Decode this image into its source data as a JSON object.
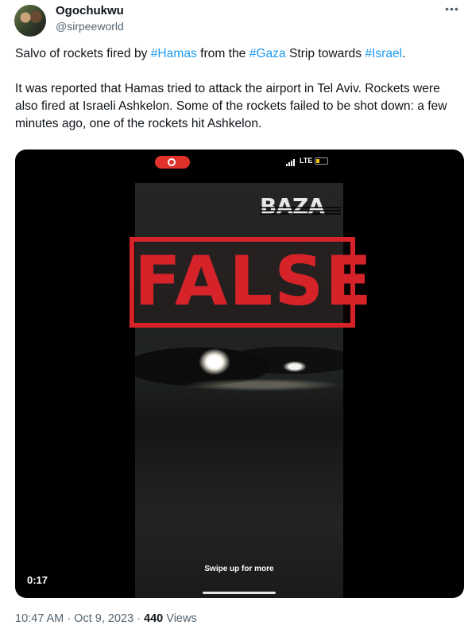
{
  "author": {
    "display_name": "Ogochukwu",
    "handle": "@sirpeeworld",
    "more_icon": "more-horizontal-icon"
  },
  "tweet": {
    "line1_part1": "Salvo of rockets fired by ",
    "hashtag1": "#Hamas",
    "line1_part2": " from the ",
    "hashtag2": "#Gaza",
    "line1_part3": " Strip towards ",
    "hashtag3": "#Israel",
    "line1_part4": ".",
    "paragraph2": "It was reported that Hamas tried to attack the airport in Tel Aviv. Rockets were also fired at Israeli Ashkelon. Some of the rockets failed to be shot down: a few minutes ago, one of the rockets hit Ashkelon.",
    "hashtag_color": "#1d9bf0"
  },
  "media": {
    "status_network": "LTE",
    "watermark": "BAZA",
    "stamp_text": "FALSE",
    "stamp_color": "#d6232a",
    "swipe_text": "Swipe up for more",
    "duration": "0:17"
  },
  "meta": {
    "time": "10:47 AM",
    "separator": "·",
    "date": "Oct 9, 2023",
    "views_count": "440",
    "views_label": "Views"
  }
}
